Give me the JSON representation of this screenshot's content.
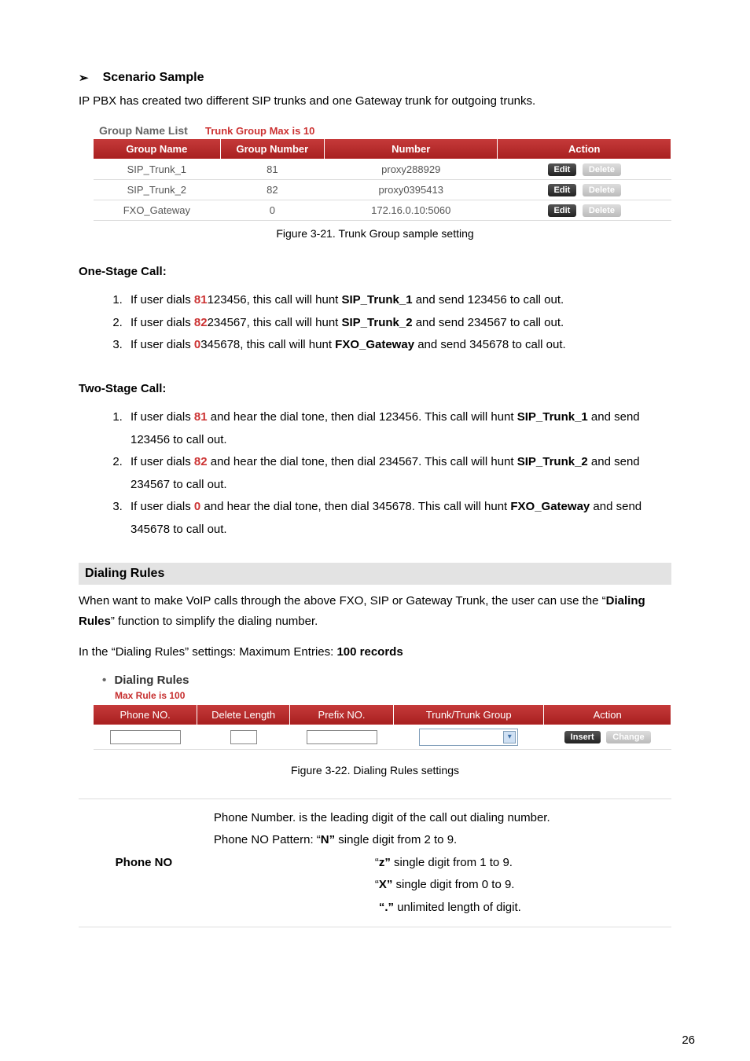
{
  "page_number": "26",
  "scenario_heading": "Scenario Sample",
  "scenario_intro": "IP PBX has created two different SIP trunks and one Gateway trunk for outgoing trunks.",
  "group_list": {
    "title": "Group Name List",
    "subtitle": "Trunk Group Max is 10",
    "headers": {
      "name": "Group Name",
      "number": "Group Number",
      "num": "Number",
      "action": "Action"
    },
    "rows": [
      {
        "name": "SIP_Trunk_1",
        "gnum": "81",
        "num": "proxy288929"
      },
      {
        "name": "SIP_Trunk_2",
        "gnum": "82",
        "num": "proxy0395413"
      },
      {
        "name": "FXO_Gateway",
        "gnum": "0",
        "num": "172.16.0.10:5060"
      }
    ],
    "btn_edit": "Edit",
    "btn_delete": "Delete",
    "caption": "Figure 3-21. Trunk Group sample setting"
  },
  "one_stage_heading": "One-Stage Call:",
  "one_stage": [
    {
      "pre": "If user dials ",
      "dial": "81",
      "mid": "123456, this call will hunt ",
      "trunk": "SIP_Trunk_1",
      "post": " and send 123456 to call out."
    },
    {
      "pre": "If user dials ",
      "dial": "82",
      "mid": "234567, this call will hunt ",
      "trunk": "SIP_Trunk_2",
      "post": " and send 234567 to call out."
    },
    {
      "pre": "If user dials ",
      "dial": "0",
      "mid": "345678, this call will hunt ",
      "trunk": "FXO_Gateway",
      "post": " and send 345678 to call out."
    }
  ],
  "two_stage_heading": "Two-Stage Call:",
  "two_stage": [
    {
      "pre": "If user dials ",
      "dial": "81",
      "mid": " and hear the dial tone, then dial 123456. This call will hunt ",
      "trunk": "SIP_Trunk_1",
      "post": " and send 123456 to call out."
    },
    {
      "pre": "If user dials ",
      "dial": "82",
      "mid": " and hear the dial tone, then dial 234567. This call will hunt ",
      "trunk": "SIP_Trunk_2",
      "post": " and send 234567 to call out."
    },
    {
      "pre": "If user dials ",
      "dial": "0",
      "mid": " and hear the dial tone, then dial 345678. This call will hunt ",
      "trunk": "FXO_Gateway",
      "post": " and send 345678 to call out."
    }
  ],
  "dialing_rules_section": "Dialing Rules",
  "dialing_rules_intro_1": "When want to make VoIP calls through the above FXO, SIP or Gateway Trunk, the user can use the “",
  "dialing_rules_intro_bold": "Dialing Rules",
  "dialing_rules_intro_2": "” function to simplify the dialing number.",
  "dialing_rules_maxline_pre": "In the “Dialing Rules” settings: Maximum Entries: ",
  "dialing_rules_maxline_bold": "100 records",
  "dr_panel": {
    "title": "Dialing Rules",
    "subtitle": "Max Rule is 100",
    "headers": {
      "phone": "Phone NO.",
      "dlen": "Delete Length",
      "prefix": "Prefix NO.",
      "trunk": "Trunk/Trunk Group",
      "action": "Action"
    },
    "btn_insert": "Insert",
    "btn_change": "Change",
    "caption": "Figure 3-22. Dialing Rules settings"
  },
  "def": {
    "key": "Phone NO",
    "line1": "Phone Number. is the leading digit of the call out dialing number.",
    "line2a": "Phone NO Pattern: “",
    "line2b": "N”",
    "line2c": " single digit from 2 to 9.",
    "line3a": "“",
    "line3b": "z”",
    "line3c": " single digit from 1 to 9.",
    "line4a": "“",
    "line4b": "X”",
    "line4c": " single digit from 0 to 9.",
    "line5a": "“.”",
    "line5b": " unlimited length of digit."
  }
}
